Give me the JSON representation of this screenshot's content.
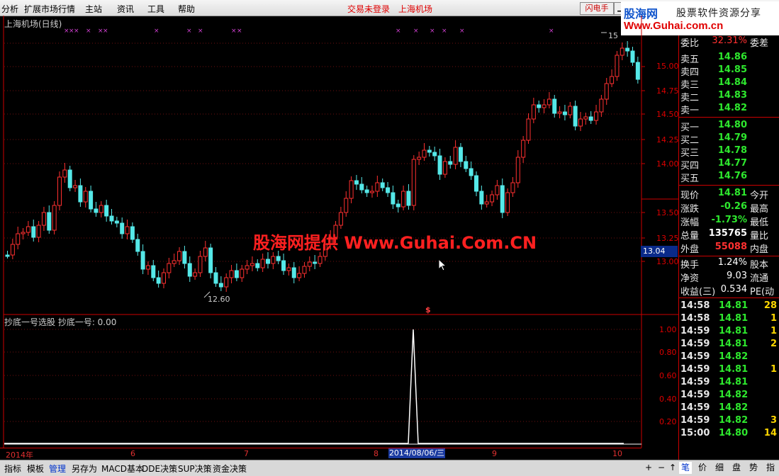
{
  "menu": {
    "items": [
      "分析",
      "扩展市场行情",
      "主站",
      "资讯",
      "工具",
      "帮助"
    ],
    "status_not_logged": "交易未登录",
    "city": "上海机场",
    "flash_button": "闪电手"
  },
  "logo": {
    "cn": "股海网",
    "slogan": "股票软件资源分享",
    "url": "Www.Guhai.com.cn"
  },
  "watermark": "股海网提供 Www.Guhai.Com.CN",
  "chart": {
    "main_title": "上海机场(日线)",
    "sub_title": "抄底一号选股  抄底一号: 0.00",
    "low_label": "12.60",
    "high_label": "15",
    "signal_mark": "$",
    "current_price_box": "13.04",
    "price_axis": [
      "15.00",
      "14.75",
      "14.50",
      "14.25",
      "14.00",
      "13.50",
      "13.25",
      "13.00"
    ],
    "ind_axis": [
      "1.00",
      "0.80",
      "0.60",
      "0.40",
      "0.20"
    ],
    "date_axis": [
      "2014年",
      "6",
      "7",
      "8",
      "9",
      "10"
    ],
    "selected_date": "2014/08/06/三"
  },
  "quote": {
    "ratio_label": "委比",
    "ratio_value": "32.31%",
    "ratio_diff": "委差",
    "sell": [
      {
        "label": "卖五",
        "price": "14.86"
      },
      {
        "label": "卖四",
        "price": "14.85"
      },
      {
        "label": "卖三",
        "price": "14.84"
      },
      {
        "label": "卖二",
        "price": "14.83"
      },
      {
        "label": "卖一",
        "price": "14.82"
      }
    ],
    "buy": [
      {
        "label": "买一",
        "price": "14.80"
      },
      {
        "label": "买二",
        "price": "14.79"
      },
      {
        "label": "买三",
        "price": "14.78"
      },
      {
        "label": "买四",
        "price": "14.77"
      },
      {
        "label": "买五",
        "price": "14.76"
      }
    ],
    "stats": [
      {
        "k": "现价",
        "v": "14.81",
        "k2": "今开",
        "color": "green"
      },
      {
        "k": "涨跌",
        "v": "-0.26",
        "k2": "最高",
        "color": "green"
      },
      {
        "k": "涨幅",
        "v": "-1.73%",
        "k2": "最低",
        "color": "green"
      },
      {
        "k": "总量",
        "v": "135765",
        "k2": "量比",
        "color": "white"
      },
      {
        "k": "外盘",
        "v": "55088",
        "k2": "内盘",
        "color": "red"
      },
      {
        "k": "换手",
        "v": "1.24%",
        "k2": "股本",
        "color": "white"
      },
      {
        "k": "净资",
        "v": "9.03",
        "k2": "流通",
        "color": "white"
      },
      {
        "k": "收益(三)",
        "v": "0.534",
        "k2": "PE(动",
        "color": "white"
      }
    ],
    "ticks": [
      {
        "t": "14:58",
        "p": "14.81",
        "q": "28"
      },
      {
        "t": "14:58",
        "p": "14.81",
        "q": "1"
      },
      {
        "t": "14:59",
        "p": "14.81",
        "q": "1"
      },
      {
        "t": "14:59",
        "p": "14.81",
        "q": "2"
      },
      {
        "t": "14:59",
        "p": "14.82",
        "q": ""
      },
      {
        "t": "14:59",
        "p": "14.81",
        "q": "1"
      },
      {
        "t": "14:59",
        "p": "14.81",
        "q": ""
      },
      {
        "t": "14:59",
        "p": "14.82",
        "q": ""
      },
      {
        "t": "14:59",
        "p": "14.82",
        "q": ""
      },
      {
        "t": "14:59",
        "p": "14.82",
        "q": "3"
      },
      {
        "t": "15:00",
        "p": "14.80",
        "q": "14"
      }
    ]
  },
  "bottom": {
    "tabs": [
      "指标",
      "模板",
      "管理",
      "另存为",
      "MACD基本",
      "DDE决策",
      "SUP决策",
      "资金决策"
    ],
    "right_tabs": [
      "+",
      "−",
      "↑",
      "笔",
      "价",
      "细",
      "盘",
      "势",
      "指"
    ]
  }
}
